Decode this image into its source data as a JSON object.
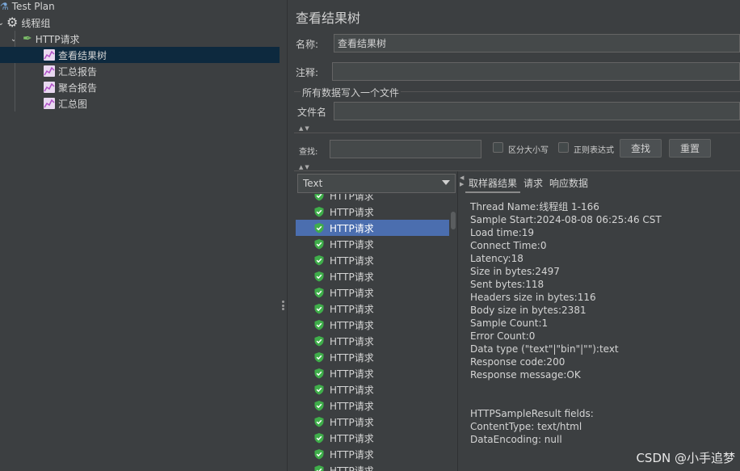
{
  "tree": {
    "test_plan": "Test Plan",
    "thread_group": "线程组",
    "http_request": "HTTP请求",
    "listeners": [
      "查看结果树",
      "汇总报告",
      "聚合报告",
      "汇总图"
    ]
  },
  "panel": {
    "title": "查看结果树",
    "name_label": "名称:",
    "name_value": "查看结果树",
    "comment_label": "注释:",
    "comment_value": "",
    "file_section_title": "所有数据写入一个文件",
    "filename_label": "文件名",
    "filename_value": "",
    "search_label": "查找:",
    "search_value": "",
    "case_sensitive_label": "区分大小写",
    "regex_label": "正则表达式",
    "find_button": "查找",
    "reset_button": "重置"
  },
  "renderer": {
    "selected": "Text"
  },
  "results": {
    "item_label": "HTTP请求"
  },
  "tabs": [
    "取样器结果",
    "请求",
    "响应数据"
  ],
  "sampler_result": [
    "Thread Name:线程组 1-166",
    "Sample Start:2024-08-08 06:25:46 CST",
    "Load time:19",
    "Connect Time:0",
    "Latency:18",
    "Size in bytes:2497",
    "Sent bytes:118",
    "Headers size in bytes:116",
    "Body size in bytes:2381",
    "Sample Count:1",
    "Error Count:0",
    "Data type (\"text\"|\"bin\"|\"\"):text",
    "Response code:200",
    "Response message:OK",
    "",
    "",
    "HTTPSampleResult fields:",
    "ContentType: text/html",
    "DataEncoding: null"
  ],
  "watermark": "CSDN @小手追梦"
}
